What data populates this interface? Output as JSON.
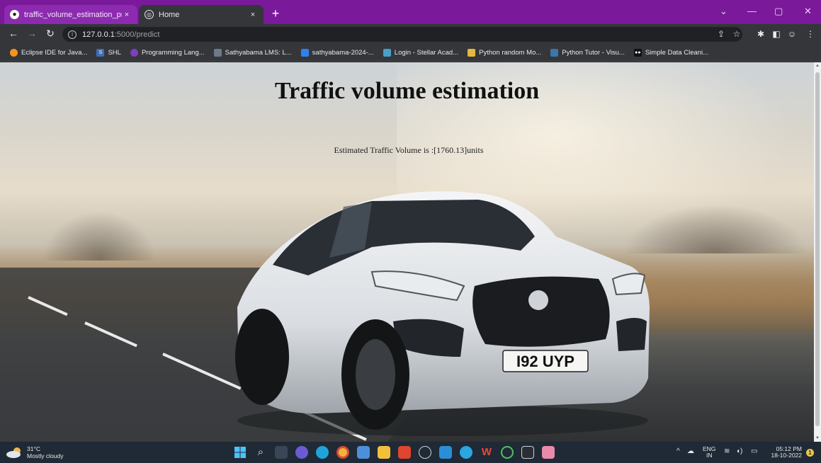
{
  "browser": {
    "tabs": [
      {
        "title": "traffic_volume_estimation_projec",
        "close": "×",
        "state": "inactive"
      },
      {
        "title": "Home",
        "close": "×",
        "state": "active"
      }
    ],
    "new_tab": "+",
    "window_controls": {
      "minimize": "—",
      "restore": "▢",
      "close": "✕",
      "tab_search": "⌄"
    },
    "url_host": "127.0.0.1",
    "url_path": ":5000/predict",
    "bookmarks": [
      {
        "label": "Eclipse IDE for Java...",
        "icon_color": "#f7941e"
      },
      {
        "label": "SHL",
        "icon_color": "#3c6fb6"
      },
      {
        "label": "Programming Lang...",
        "icon_color": "#7b3fbf"
      },
      {
        "label": "Sathyabama LMS: L...",
        "icon_color": "#6c7a89"
      },
      {
        "label": "sathyabama-2024-...",
        "icon_color": "#2f80ed"
      },
      {
        "label": "Login - Stellar Acad...",
        "icon_color": "#46a0c8"
      },
      {
        "label": "Python random Mo...",
        "icon_color": "#e5b740"
      },
      {
        "label": "Python Tutor - Visu...",
        "icon_color": "#3b77a8"
      },
      {
        "label": "Simple Data Cleani...",
        "icon_color": "#111111"
      }
    ]
  },
  "page": {
    "title": "Traffic volume estimation",
    "result": "Estimated Traffic Volume is :[1760.13]units",
    "car_plate": "I92 UYP"
  },
  "taskbar": {
    "weather_temp": "31°C",
    "weather_desc": "Mostly cloudy",
    "language": "ENG",
    "region": "IN",
    "time": "05:12 PM",
    "date": "18-10-2022",
    "notification_count": "1"
  },
  "colors": {
    "tab_strip": "#7a1a9a",
    "toolbar": "#35363a",
    "taskbar": "#1f2a36"
  }
}
